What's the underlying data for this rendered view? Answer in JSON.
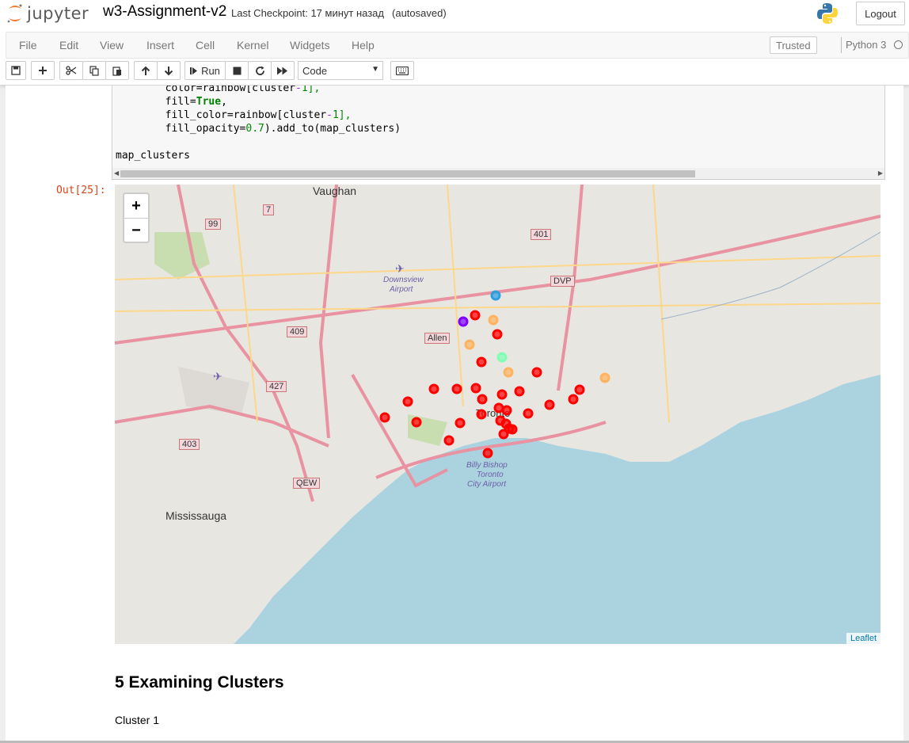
{
  "header": {
    "logo_text": "jupyter",
    "notebook_name": "w3-Assignment-v2",
    "checkpoint": "Last Checkpoint: 17 минут назад",
    "autosave": "(autosaved)",
    "logout_label": "Logout"
  },
  "menu": {
    "items": [
      "File",
      "Edit",
      "View",
      "Insert",
      "Cell",
      "Kernel",
      "Widgets",
      "Help"
    ],
    "trusted": "Trusted",
    "kernel": "Python 3"
  },
  "toolbar": {
    "run_label": "Run",
    "cell_type": "Code"
  },
  "code": {
    "line1_a": "        color=rainbow[cluster",
    "line1_b": "-",
    "line1_c": "1],",
    "line2_a": "        fill=",
    "line2_b": "True",
    "line2_c": ",",
    "line3_a": "        fill_color=rainbow[cluster",
    "line3_b": "-",
    "line3_c": "1],",
    "line4_a": "        fill_opacity=",
    "line4_b": "0.7",
    "line4_c": ").add_to(map_clusters)",
    "line6": "map_clusters"
  },
  "output": {
    "prompt": "Out[25]:",
    "zoom_in": "+",
    "zoom_out": "−",
    "attribution": "Leaflet",
    "map_labels": {
      "vaughan": "Vaughan",
      "mississauga": "Mississauga",
      "toronto": "Toronto",
      "downsview": "Downsview",
      "airport": "Airport",
      "billy1": "Billy Bishop",
      "billy2": "Toronto",
      "billy3": "City Airport",
      "allen": "Allen",
      "dvp": "DVP",
      "qew": "QEW",
      "h401": "401",
      "h409": "409",
      "h427": "427",
      "h403": "403",
      "h99": "99",
      "h7": "7"
    },
    "markers": [
      {
        "cluster": "red"
      },
      {
        "cluster": "red"
      },
      {
        "cluster": "red"
      },
      {
        "cluster": "red"
      },
      {
        "cluster": "red"
      },
      {
        "cluster": "red"
      },
      {
        "cluster": "red"
      },
      {
        "cluster": "red"
      },
      {
        "cluster": "red"
      },
      {
        "cluster": "red"
      },
      {
        "cluster": "red"
      },
      {
        "cluster": "red"
      },
      {
        "cluster": "red"
      },
      {
        "cluster": "red"
      },
      {
        "cluster": "red"
      },
      {
        "cluster": "red"
      },
      {
        "cluster": "red"
      },
      {
        "cluster": "red"
      },
      {
        "cluster": "red"
      },
      {
        "cluster": "red"
      },
      {
        "cluster": "red"
      },
      {
        "cluster": "red"
      },
      {
        "cluster": "red"
      },
      {
        "cluster": "red"
      },
      {
        "cluster": "red"
      },
      {
        "cluster": "red"
      },
      {
        "cluster": "red"
      },
      {
        "cluster": "red"
      },
      {
        "cluster": "purple"
      },
      {
        "cluster": "blue"
      },
      {
        "cluster": "teal"
      },
      {
        "cluster": "orange"
      },
      {
        "cluster": "orange"
      },
      {
        "cluster": "orange"
      },
      {
        "cluster": "orange"
      }
    ],
    "colors": {
      "red": "#ff0000",
      "purple": "#8000ff",
      "blue": "#2c9fdf",
      "teal": "#80ffb4",
      "orange": "#ffb360"
    }
  },
  "markdown": {
    "heading": "5 Examining Clusters",
    "text": "Cluster 1"
  }
}
